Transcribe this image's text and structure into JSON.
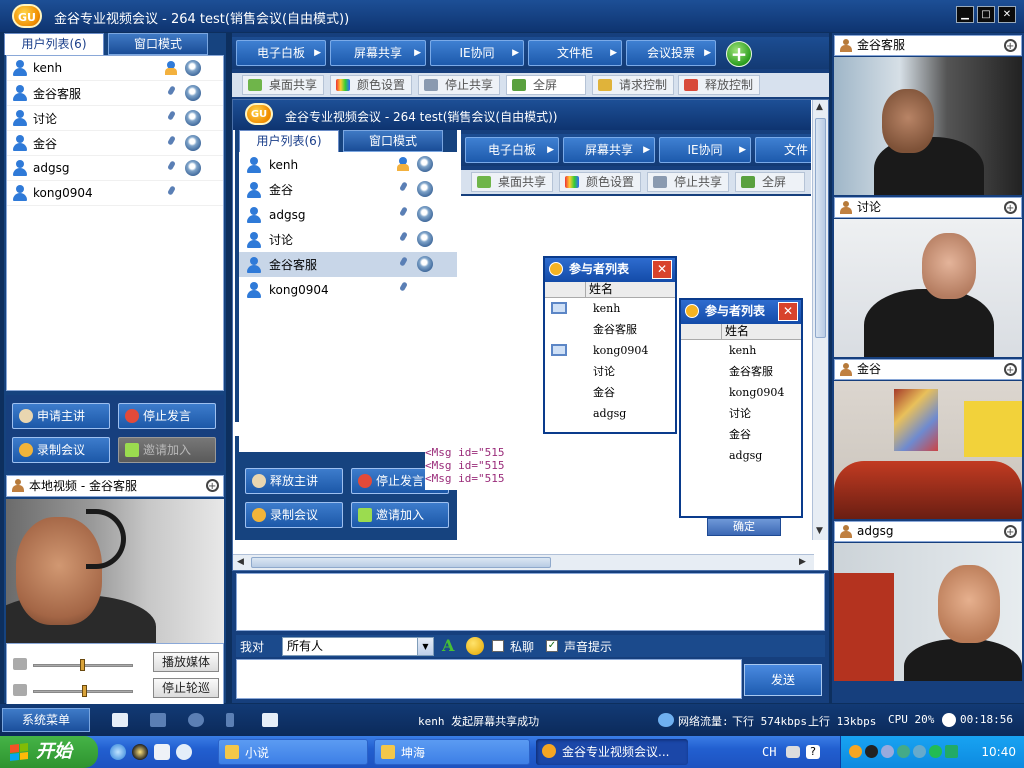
{
  "window": {
    "title": "金谷专业视频会议 - 264 test(销售会议(自由模式))",
    "logo_text": "GU",
    "minimize": "▁",
    "maximize": "□",
    "close": "✕"
  },
  "left_panel": {
    "tab_users": "用户列表(6)",
    "tab_window_mode": "窗口模式",
    "users": [
      {
        "name": "kenh",
        "has_camera": true,
        "is_master": true
      },
      {
        "name": "金谷客服",
        "has_camera": true,
        "is_master": false
      },
      {
        "name": "讨论",
        "has_camera": true,
        "is_master": false
      },
      {
        "name": "金谷",
        "has_camera": true,
        "is_master": false
      },
      {
        "name": "adgsg",
        "has_camera": true,
        "is_master": false
      },
      {
        "name": "kong0904",
        "has_camera": false,
        "is_master": false
      }
    ],
    "buttons": {
      "request_host": "申请主讲",
      "stop_speaking": "停止发言",
      "record_meeting": "录制会议",
      "invite_join": "邀请加入"
    },
    "local_video_title": "本地视频 - 金谷客服",
    "media_play": "播放媒体",
    "stop_rotation": "停止轮巡"
  },
  "toolbar": {
    "whiteboard": "电子白板",
    "screen_share": "屏幕共享",
    "ie_cobrowse": "IE协同",
    "file_cabinet": "文件柜",
    "meeting_vote": "会议投票",
    "add": "+",
    "arrow": "▶"
  },
  "subtoolbar": {
    "desktop_share": "桌面共享",
    "color_settings": "颜色设置",
    "stop_share": "停止共享",
    "fullscreen": "全屏",
    "request_control": "请求控制",
    "release_control": "释放控制"
  },
  "shared_screen": {
    "title": "金谷专业视频会议 - 264 test(销售会议(自由模式))",
    "logo_text": "GU",
    "tab_users": "用户列表(6)",
    "tab_window_mode": "窗口模式",
    "users": [
      {
        "name": "kenh"
      },
      {
        "name": "金谷"
      },
      {
        "name": "adgsg"
      },
      {
        "name": "讨论"
      },
      {
        "name": "金谷客服"
      },
      {
        "name": "kong0904"
      }
    ],
    "buttons": {
      "release_host": "释放主讲",
      "stop_speaking": "停止发言",
      "record_meeting": "录制会议",
      "invite_join": "邀请加入"
    },
    "toolbar": {
      "whiteboard": "电子白板",
      "screen_share": "屏幕共享",
      "ie_cobrowse": "IE协同",
      "file_cabinet": "文件"
    },
    "subtoolbar": {
      "desktop_share": "桌面共享",
      "color_settings": "颜色设置",
      "stop_share": "停止共享",
      "fullscreen": "全屏"
    },
    "code_lines": [
      "<Msg id=\"515",
      "<Msg id=\"515",
      "<Msg id=\"515"
    ],
    "dialog_confirm": "确定"
  },
  "participants_dialog": {
    "title": "参与者列表",
    "column": "姓名",
    "close": "✕",
    "items": [
      "kenh",
      "金谷客服",
      "kong0904",
      "讨论",
      "金谷",
      "adgsg"
    ]
  },
  "participants_dialog_back": {
    "title": "参与者列表",
    "column": "姓名",
    "close": "✕",
    "items": [
      "kenh",
      "金谷客服",
      "kong0904",
      "讨论",
      "金谷",
      "adgsg"
    ]
  },
  "chat": {
    "to_label": "我对",
    "recipient": "所有人",
    "font_icon": "A",
    "private_chat": "私聊",
    "sound_alert": "声音提示",
    "send": "发送"
  },
  "video_wall": [
    {
      "name": "金谷客服"
    },
    {
      "name": "讨论"
    },
    {
      "name": "金谷"
    },
    {
      "name": "adgsg"
    }
  ],
  "status_bar": {
    "system_menu": "系统菜单",
    "message": "kenh 发起屏幕共享成功",
    "network_label": "网络流量:",
    "down": "下行 574kbps",
    "up": "上行 13kbps",
    "cpu": "CPU 20%",
    "timer": "00:18:56"
  },
  "taskbar": {
    "start": "开始",
    "tasks": [
      "小说",
      "坤海",
      "金谷专业视频会议..."
    ],
    "lang": "CH",
    "clock": "10:40",
    "help": "?"
  }
}
